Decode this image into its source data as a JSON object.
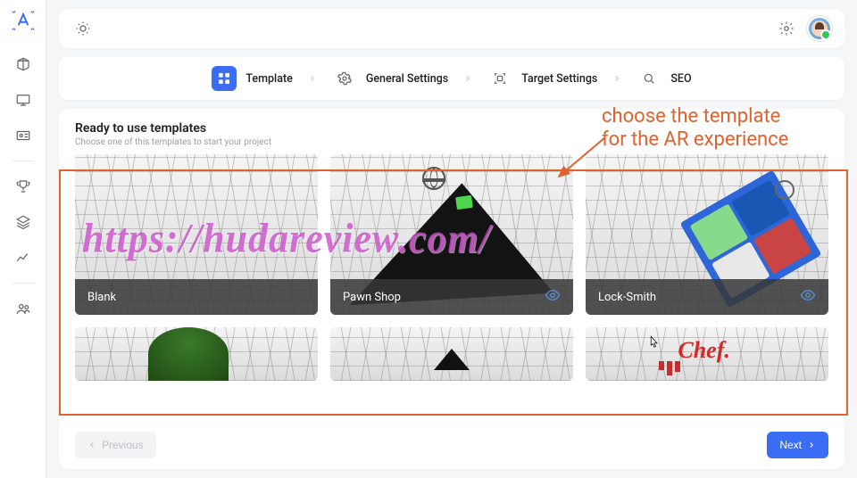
{
  "sidebar": {
    "icons": [
      "logo",
      "3d",
      "monitor",
      "id-card",
      "trophy",
      "layers",
      "chart",
      "users"
    ]
  },
  "stepper": {
    "steps": [
      {
        "label": "Template",
        "icon": "grid",
        "active": true
      },
      {
        "label": "General Settings",
        "icon": "gear",
        "active": false
      },
      {
        "label": "Target Settings",
        "icon": "scan",
        "active": false
      },
      {
        "label": "SEO",
        "icon": "search",
        "active": false
      }
    ]
  },
  "section": {
    "title": "Ready to use templates",
    "subtitle": "Choose one of this templates to start your project"
  },
  "templates": [
    {
      "name": "Blank",
      "selected": true
    },
    {
      "name": "Pawn Shop",
      "selected": false
    },
    {
      "name": "Lock-Smith",
      "selected": false
    },
    {
      "name": "",
      "selected": false
    },
    {
      "name": "",
      "selected": false
    },
    {
      "name": "Chef.",
      "selected": false
    }
  ],
  "footer": {
    "prev": "Previous",
    "next": "Next"
  },
  "annotation": {
    "text": "choose the template\nfor the AR experience"
  },
  "watermark": "https://hudareview.com/"
}
